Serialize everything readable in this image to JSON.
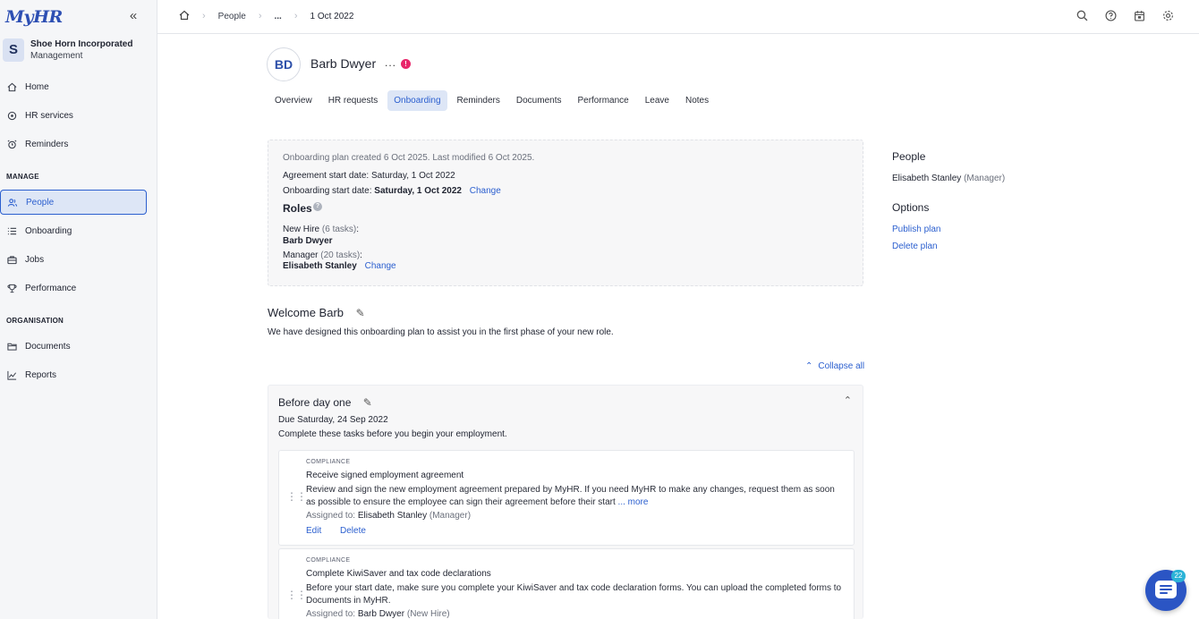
{
  "app": {
    "logo_text": "MyHR",
    "brand_color": "#2d4fb3",
    "accent_color": "#2b5fcf"
  },
  "org": {
    "initial": "S",
    "name": "Shoe Horn Incorporated",
    "role": "Management"
  },
  "sidebar": {
    "top_items": [
      {
        "label": "Home",
        "icon": "home-icon"
      },
      {
        "label": "HR services",
        "icon": "hr-services-icon"
      },
      {
        "label": "Reminders",
        "icon": "alarm-clock-icon"
      }
    ],
    "manage_label": "MANAGE",
    "manage_items": [
      {
        "label": "People",
        "icon": "people-icon",
        "active": true
      },
      {
        "label": "Onboarding",
        "icon": "checklist-icon"
      },
      {
        "label": "Jobs",
        "icon": "briefcase-icon"
      },
      {
        "label": "Performance",
        "icon": "trophy-icon"
      }
    ],
    "org_label": "ORGANISATION",
    "org_items": [
      {
        "label": "Documents",
        "icon": "folder-icon"
      },
      {
        "label": "Reports",
        "icon": "chart-icon"
      }
    ]
  },
  "breadcrumb": {
    "people": "People",
    "ellipsis": "...",
    "current": "1 Oct 2022"
  },
  "person": {
    "initials": "BD",
    "name": "Barb Dwyer",
    "more": "...",
    "alert": "!"
  },
  "tabs": [
    "Overview",
    "HR requests",
    "Onboarding",
    "Reminders",
    "Documents",
    "Performance",
    "Leave",
    "Notes"
  ],
  "active_tab": "Onboarding",
  "plan": {
    "meta": "Onboarding plan created 6 Oct 2025. Last modified 6 Oct 2025.",
    "agreement_label": "Agreement start date: Saturday, 1 Oct 2022",
    "onboarding_label": "Onboarding start date:",
    "onboarding_value": "Saturday, 1 Oct 2022",
    "change": "Change",
    "roles_title": "Roles",
    "roles": [
      {
        "role": "New Hire",
        "tasks": "(6 tasks)",
        "person": "Barb Dwyer",
        "changeable": false
      },
      {
        "role": "Manager",
        "tasks": "(20 tasks)",
        "person": "Elisabeth Stanley",
        "changeable": true
      }
    ]
  },
  "side": {
    "people_title": "People",
    "manager_name": "Elisabeth Stanley",
    "manager_role": "(Manager)",
    "options_title": "Options",
    "publish": "Publish plan",
    "delete": "Delete plan"
  },
  "welcome": {
    "title": "Welcome Barb",
    "text": "We have designed this onboarding plan to assist you in the first phase of your new role."
  },
  "collapse_all": "Collapse all",
  "section": {
    "title": "Before day one",
    "due": "Due Saturday, 24 Sep 2022",
    "desc": "Complete these tasks before you begin your employment.",
    "tasks": [
      {
        "category": "COMPLIANCE",
        "title": "Receive signed employment agreement",
        "desc": "Review and sign the new employment agreement prepared by MyHR. If you need MyHR to make any changes, request them as soon as possible to ensure the employee can sign their agreement before their start",
        "more": "... more",
        "assigned_label": "Assigned to:",
        "assignee": "Elisabeth Stanley",
        "assignee_role": "(Manager)",
        "edit": "Edit",
        "delete": "Delete"
      },
      {
        "category": "COMPLIANCE",
        "title": "Complete KiwiSaver and tax code declarations",
        "desc": "Before your start date, make sure you complete your KiwiSaver and tax code declaration forms. You can upload the completed forms to Documents in MyHR.",
        "assigned_label": "Assigned to:",
        "assignee": "Barb Dwyer",
        "assignee_role": "(New Hire)"
      }
    ]
  },
  "chat": {
    "badge": "22"
  }
}
